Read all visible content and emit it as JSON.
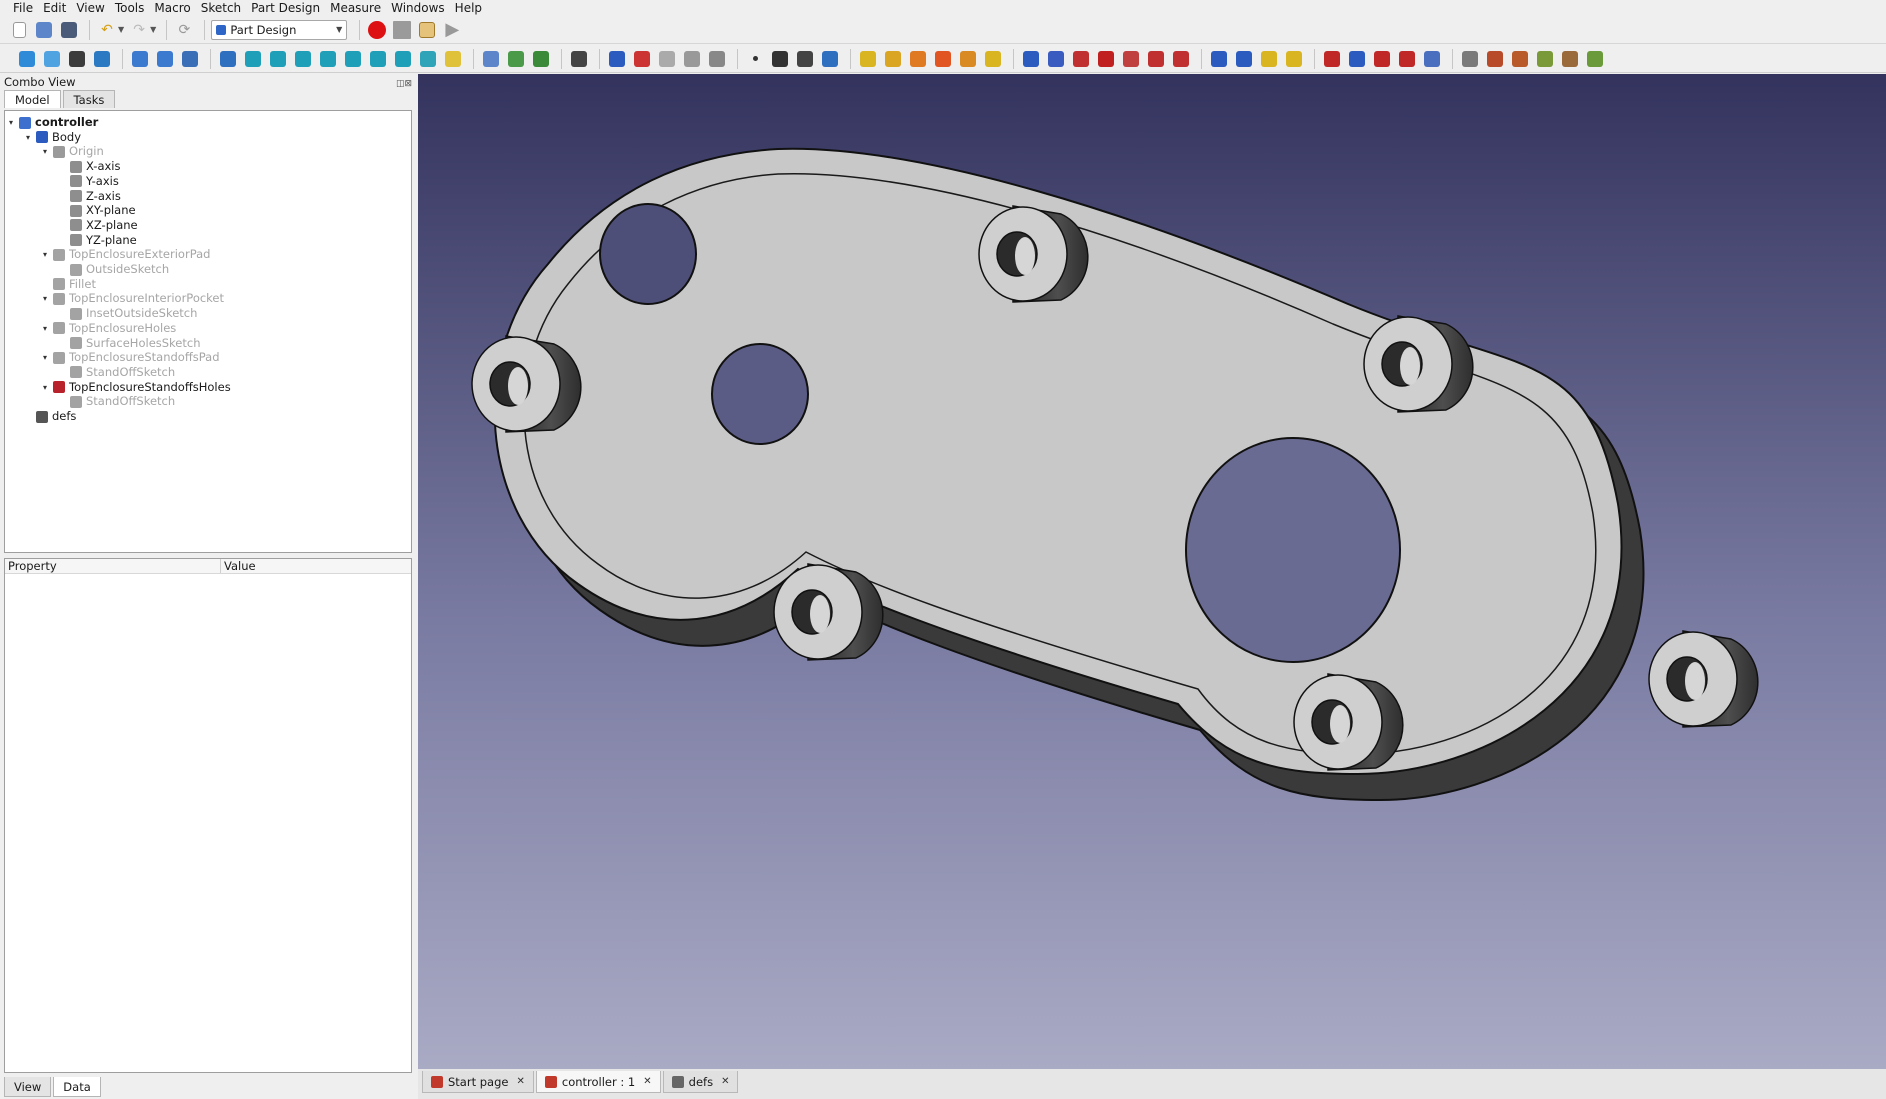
{
  "menubar": [
    "File",
    "Edit",
    "View",
    "Tools",
    "Macro",
    "Sketch",
    "Part Design",
    "Measure",
    "Windows",
    "Help"
  ],
  "toolbar": {
    "workbench": "Part Design",
    "icons_row1": [
      "new-file-icon",
      "open-file-icon",
      "save-icon",
      "undo-icon",
      "redo-icon",
      "refresh-icon"
    ],
    "macro_icons": [
      "record-macro-icon",
      "stop-macro-icon",
      "edit-macro-icon",
      "run-macro-icon"
    ],
    "icons_row2": [
      "fit-all-icon",
      "fit-selection-icon",
      "draw-style-icon",
      "stereo-icon",
      "back-icon",
      "forward-icon",
      "sync-view-icon",
      "zoom-icon",
      "isometric-view-icon",
      "front-view-icon",
      "top-view-icon",
      "right-view-icon",
      "rear-view-icon",
      "bottom-view-icon",
      "left-view-icon",
      "measure-icon",
      "part-icon",
      "group-icon",
      "link-icon",
      "link-actions-icon",
      "whats-this-icon",
      "body-icon",
      "validate-sketch-icon",
      "sketch-icon",
      "shape-binder-icon",
      "clone-icon",
      "point-icon",
      "line-icon",
      "plane-icon",
      "lcs-icon",
      "pad-icon",
      "revolution-icon",
      "loft-icon",
      "pipe-icon",
      "additive-helix-icon",
      "additive-primitive-icon",
      "pocket-icon",
      "hole-icon",
      "groove-icon",
      "subtractive-loft-icon",
      "subtractive-pipe-icon",
      "subtractive-helix-icon",
      "subtractive-primitive-icon",
      "mirrored-icon",
      "linear-pattern-icon",
      "polar-pattern-icon",
      "multitransform-icon",
      "fillet-icon",
      "chamfer-icon",
      "draft-icon",
      "thickness-icon",
      "boolean-icon",
      "sprocket-icon",
      "involute-gear-icon",
      "shaft-wizard-icon",
      "hole-feature-icon",
      "migrate-icon",
      "sketch-attach-icon"
    ]
  },
  "combo": {
    "title": "Combo View",
    "tabs": [
      "Model",
      "Tasks"
    ],
    "tree": [
      {
        "label": "controller",
        "depth": 0,
        "arrow": "▾",
        "style": "bold",
        "icon": "#3d6fcf"
      },
      {
        "label": "Body",
        "depth": 1,
        "arrow": "▾",
        "style": "",
        "icon": "#2b5bbf"
      },
      {
        "label": "Origin",
        "depth": 2,
        "arrow": "▾",
        "style": "muted",
        "icon": "#9a9a9a"
      },
      {
        "label": "X-axis",
        "depth": 3,
        "arrow": "",
        "style": "",
        "icon": "#8e8e8e"
      },
      {
        "label": "Y-axis",
        "depth": 3,
        "arrow": "",
        "style": "",
        "icon": "#8e8e8e"
      },
      {
        "label": "Z-axis",
        "depth": 3,
        "arrow": "",
        "style": "",
        "icon": "#8e8e8e"
      },
      {
        "label": "XY-plane",
        "depth": 3,
        "arrow": "",
        "style": "",
        "icon": "#8e8e8e"
      },
      {
        "label": "XZ-plane",
        "depth": 3,
        "arrow": "",
        "style": "",
        "icon": "#8e8e8e"
      },
      {
        "label": "YZ-plane",
        "depth": 3,
        "arrow": "",
        "style": "",
        "icon": "#8e8e8e"
      },
      {
        "label": "TopEnclosureExteriorPad",
        "depth": 2,
        "arrow": "▾",
        "style": "muted",
        "icon": "#a3a3a3"
      },
      {
        "label": "OutsideSketch",
        "depth": 3,
        "arrow": "",
        "style": "muted",
        "icon": "#a3a3a3"
      },
      {
        "label": "Fillet",
        "depth": 2,
        "arrow": "",
        "style": "muted",
        "icon": "#a3a3a3"
      },
      {
        "label": "TopEnclosureInteriorPocket",
        "depth": 2,
        "arrow": "▾",
        "style": "muted",
        "icon": "#a3a3a3"
      },
      {
        "label": "InsetOutsideSketch",
        "depth": 3,
        "arrow": "",
        "style": "muted",
        "icon": "#a3a3a3"
      },
      {
        "label": "TopEnclosureHoles",
        "depth": 2,
        "arrow": "▾",
        "style": "muted",
        "icon": "#a3a3a3"
      },
      {
        "label": "SurfaceHolesSketch",
        "depth": 3,
        "arrow": "",
        "style": "muted",
        "icon": "#a3a3a3"
      },
      {
        "label": "TopEnclosureStandoffsPad",
        "depth": 2,
        "arrow": "▾",
        "style": "muted",
        "icon": "#a3a3a3"
      },
      {
        "label": "StandOffSketch",
        "depth": 3,
        "arrow": "",
        "style": "muted",
        "icon": "#a3a3a3"
      },
      {
        "label": "TopEnclosureStandoffsHoles",
        "depth": 2,
        "arrow": "▾",
        "style": "",
        "icon": "#b8222a"
      },
      {
        "label": "StandOffSketch",
        "depth": 3,
        "arrow": "",
        "style": "muted",
        "icon": "#a3a3a3"
      },
      {
        "label": "defs",
        "depth": 1,
        "arrow": "",
        "style": "",
        "icon": "#555555"
      }
    ],
    "property_headers": [
      "Property",
      "Value"
    ],
    "bottom_tabs": [
      "View",
      "Data"
    ]
  },
  "doc_tabs": [
    {
      "label": "Start page",
      "icon": "#c0392b",
      "active": false
    },
    {
      "label": "controller : 1",
      "icon": "#c0392b",
      "active": true
    },
    {
      "label": "defs",
      "icon": "#666666",
      "active": false
    }
  ]
}
